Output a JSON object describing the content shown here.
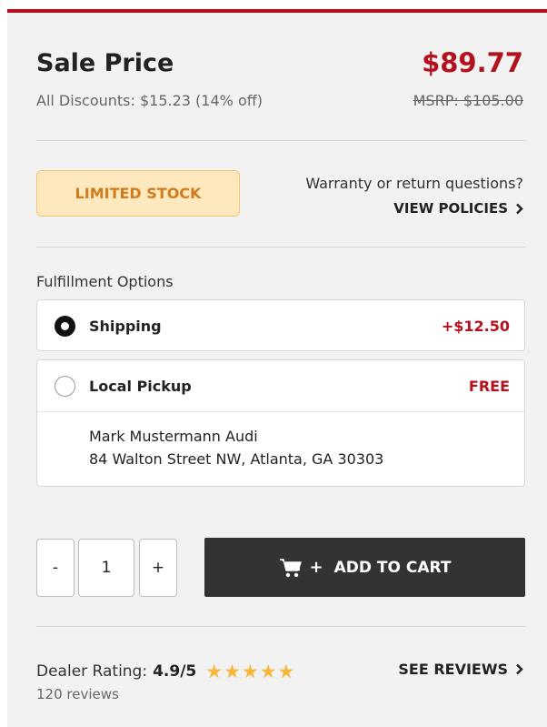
{
  "price": {
    "title": "Sale Price",
    "sale_price": "$89.77",
    "discounts": "All Discounts: $15.23 (14% off)",
    "msrp": "MSRP: $105.00"
  },
  "stock": {
    "badge": "LIMITED STOCK",
    "warranty_question": "Warranty or return questions?",
    "view_policies": "VIEW POLICIES"
  },
  "fulfillment": {
    "label": "Fulfillment Options",
    "options": [
      {
        "label": "Shipping",
        "price": "+$12.50",
        "selected": true
      },
      {
        "label": "Local Pickup",
        "price": "FREE",
        "selected": false,
        "dealer_name": "Mark Mustermann Audi",
        "dealer_address": "84 Walton Street NW, Atlanta, GA 30303"
      }
    ]
  },
  "cart": {
    "minus": "-",
    "quantity": "1",
    "plus": "+",
    "add_label": "ADD TO CART",
    "icon": "cart-plus-icon"
  },
  "rating": {
    "label": "Dealer Rating:",
    "value": "4.9/5",
    "stars": 5,
    "review_count": "120 reviews",
    "see_reviews": "SEE REVIEWS"
  },
  "colors": {
    "accent_red": "#b3111d",
    "stock_badge_bg": "#fde9bd",
    "star": "#f6b73c",
    "button_dark": "#333333"
  }
}
